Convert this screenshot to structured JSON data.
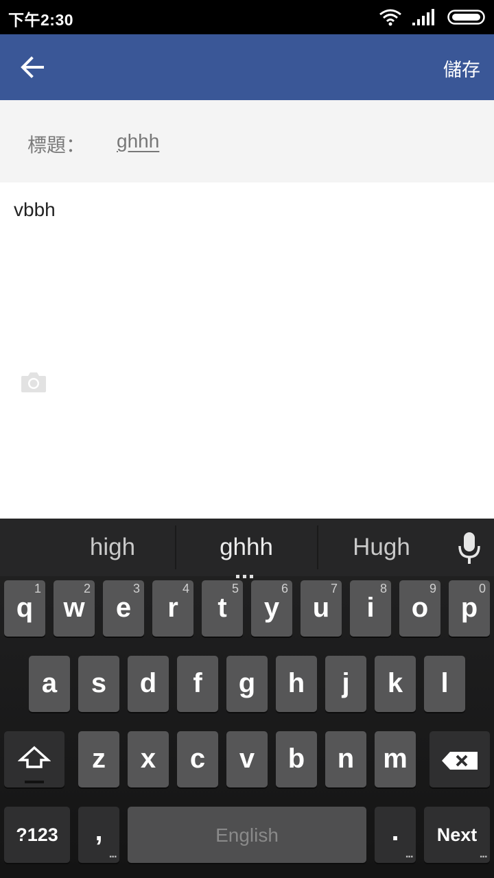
{
  "status_bar": {
    "time": "下午2:30",
    "icons": [
      "wifi-icon",
      "signal-icon",
      "battery-icon"
    ]
  },
  "app_bar": {
    "back_icon": "arrow-left-icon",
    "save_label": "儲存",
    "color": "#3a5797"
  },
  "editor": {
    "title_label": "標題：",
    "title_value": "ghhh",
    "body_value": "vbbh",
    "camera_icon": "camera-icon"
  },
  "keyboard": {
    "suggestions": [
      "high",
      "ghhh",
      "Hugh"
    ],
    "mic_icon": "microphone-icon",
    "row1": [
      {
        "label": "q",
        "hint": "1"
      },
      {
        "label": "w",
        "hint": "2"
      },
      {
        "label": "e",
        "hint": "3"
      },
      {
        "label": "r",
        "hint": "4"
      },
      {
        "label": "t",
        "hint": "5"
      },
      {
        "label": "y",
        "hint": "6"
      },
      {
        "label": "u",
        "hint": "7"
      },
      {
        "label": "i",
        "hint": "8"
      },
      {
        "label": "o",
        "hint": "9"
      },
      {
        "label": "p",
        "hint": "0"
      }
    ],
    "row2": [
      "a",
      "s",
      "d",
      "f",
      "g",
      "h",
      "j",
      "k",
      "l"
    ],
    "row3": [
      "z",
      "x",
      "c",
      "v",
      "b",
      "n",
      "m"
    ],
    "symbols_label": "?123",
    "comma_label": ",",
    "space_label": "English",
    "period_label": ".",
    "next_label": "Next"
  }
}
